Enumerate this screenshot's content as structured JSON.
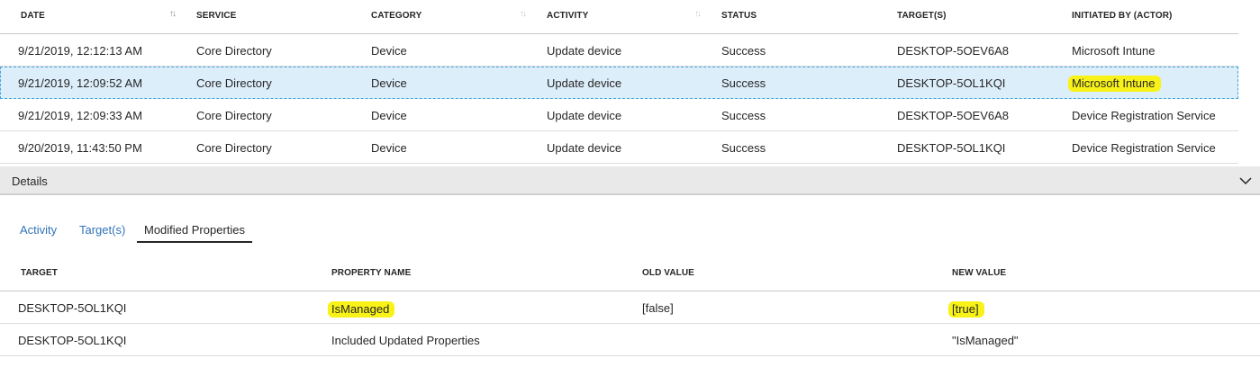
{
  "audit_table": {
    "columns": {
      "date": "DATE",
      "service": "SERVICE",
      "category": "CATEGORY",
      "activity": "ACTIVITY",
      "status": "STATUS",
      "targets": "TARGET(S)",
      "initiated_by": "INITIATED BY (ACTOR)"
    },
    "rows": [
      {
        "date": "9/21/2019, 12:12:13 AM",
        "service": "Core Directory",
        "category": "Device",
        "activity": "Update device",
        "status": "Success",
        "target": "DESKTOP-5OEV6A8",
        "actor": "Microsoft Intune"
      },
      {
        "date": "9/21/2019, 12:09:52 AM",
        "service": "Core Directory",
        "category": "Device",
        "activity": "Update device",
        "status": "Success",
        "target": "DESKTOP-5OL1KQI",
        "actor": "Microsoft Intune"
      },
      {
        "date": "9/21/2019, 12:09:33 AM",
        "service": "Core Directory",
        "category": "Device",
        "activity": "Update device",
        "status": "Success",
        "target": "DESKTOP-5OEV6A8",
        "actor": "Device Registration Service"
      },
      {
        "date": "9/20/2019, 11:43:50 PM",
        "service": "Core Directory",
        "category": "Device",
        "activity": "Update device",
        "status": "Success",
        "target": "DESKTOP-5OL1KQI",
        "actor": "Device Registration Service"
      }
    ]
  },
  "details": {
    "title": "Details",
    "tabs": [
      "Activity",
      "Target(s)",
      "Modified Properties"
    ],
    "active_tab": "Modified Properties"
  },
  "modified_properties": {
    "columns": {
      "target": "TARGET",
      "property_name": "PROPERTY NAME",
      "old_value": "OLD VALUE",
      "new_value": "NEW VALUE"
    },
    "rows": [
      {
        "target": "DESKTOP-5OL1KQI",
        "property_name": "IsManaged",
        "old_value": "[false]",
        "new_value": "[true]"
      },
      {
        "target": "DESKTOP-5OL1KQI",
        "property_name": "Included Updated Properties",
        "old_value": "",
        "new_value": "\"IsManaged\""
      }
    ]
  },
  "colors": {
    "selected_row": "#ddeefb",
    "highlight": "#f8f218",
    "link": "#2f73b8"
  },
  "icons": {
    "sort": "sort-arrows-icon",
    "collapse": "chevron-down-icon"
  }
}
